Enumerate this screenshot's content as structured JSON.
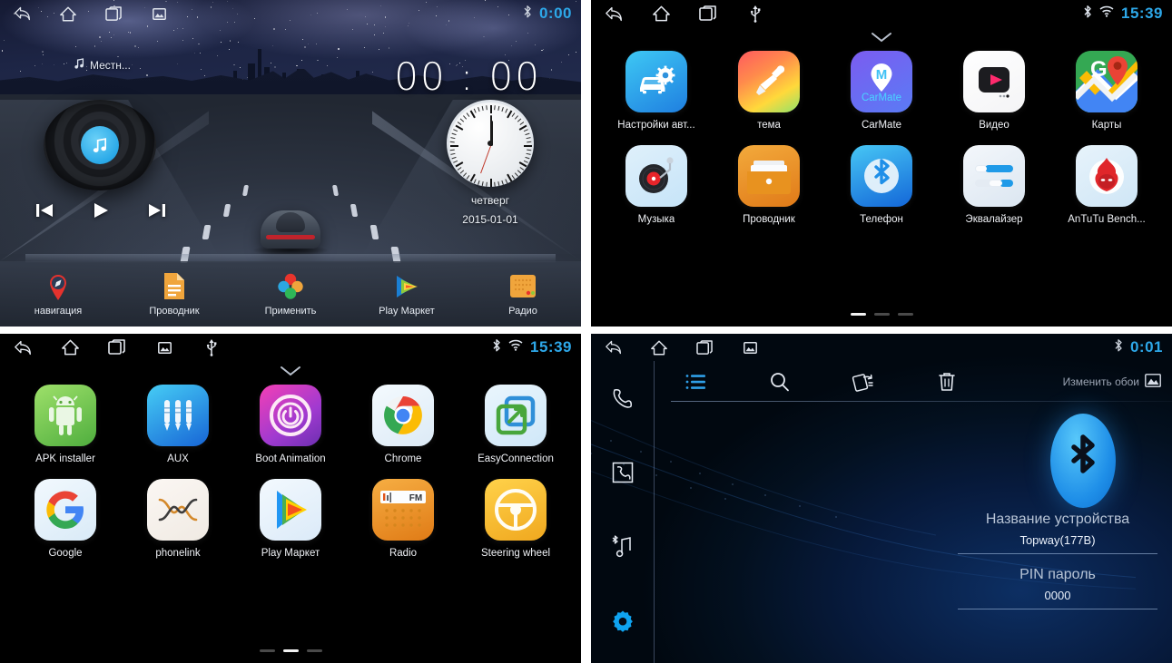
{
  "panels": {
    "home": {
      "statusbar": {
        "nav": [
          "back-icon",
          "home-icon",
          "recents-icon",
          "screenshot-icon"
        ],
        "bluetooth_icon": "bluetooth-icon",
        "time": "0:00"
      },
      "music_widget": {
        "source_label": "Местн...",
        "note_icon": "music-note-icon",
        "prev_label": "prev-track",
        "play_label": "play",
        "next_label": "next-track"
      },
      "clock_widget": {
        "digital_time": "00 : 00",
        "day_name": "четверг",
        "date": "2015-01-01",
        "hour_deg": 0,
        "minute_deg": 0,
        "second_deg": 200
      },
      "dock": [
        {
          "label": "навигация",
          "icon": "navigation-pin-icon"
        },
        {
          "label": "Проводник",
          "icon": "file-manager-icon"
        },
        {
          "label": "Применить",
          "icon": "apply-petals-icon"
        },
        {
          "label": "Play Маркет",
          "icon": "play-store-icon"
        },
        {
          "label": "Радио",
          "icon": "radio-icon"
        }
      ]
    },
    "drawer_page1": {
      "statusbar": {
        "nav": [
          "back-icon",
          "home-icon",
          "recents-icon",
          "usb-icon"
        ],
        "bluetooth_icon": "bluetooth-icon",
        "wifi_icon": "wifi-icon",
        "time": "15:39"
      },
      "caret": "chevron-down-icon",
      "apps": [
        {
          "label": "Настройки авт...",
          "icon": "car-settings-icon"
        },
        {
          "label": "тема",
          "icon": "theme-brush-icon"
        },
        {
          "label": "CarMate",
          "icon": "carmate-icon"
        },
        {
          "label": "Видео",
          "icon": "video-icon"
        },
        {
          "label": "Карты",
          "icon": "google-maps-icon"
        },
        {
          "label": "Музыка",
          "icon": "music-turntable-icon"
        },
        {
          "label": "Проводник",
          "icon": "file-folder-icon"
        },
        {
          "label": "Телефон",
          "icon": "bluetooth-phone-icon"
        },
        {
          "label": "Эквалайзер",
          "icon": "equalizer-icon"
        },
        {
          "label": "AnTuTu Bench...",
          "icon": "antutu-icon"
        }
      ],
      "pages": 3,
      "active_page": 1
    },
    "drawer_page2": {
      "statusbar": {
        "nav": [
          "back-icon",
          "home-icon",
          "recents-icon",
          "screenshot-icon",
          "usb-icon"
        ],
        "bluetooth_icon": "bluetooth-icon",
        "wifi_icon": "wifi-icon",
        "time": "15:39"
      },
      "caret": "chevron-down-icon",
      "apps": [
        {
          "label": "APK installer",
          "icon": "android-robot-icon"
        },
        {
          "label": "AUX",
          "icon": "aux-jack-icon"
        },
        {
          "label": "Boot Animation",
          "icon": "power-ring-icon"
        },
        {
          "label": "Chrome",
          "icon": "chrome-icon"
        },
        {
          "label": "EasyConnection",
          "icon": "easyconnection-icon"
        },
        {
          "label": "Google",
          "icon": "google-g-icon"
        },
        {
          "label": "phonelink",
          "icon": "phonelink-icon"
        },
        {
          "label": "Play Маркет",
          "icon": "play-store-icon"
        },
        {
          "label": "Radio",
          "icon": "fm-radio-icon"
        },
        {
          "label": "Steering wheel",
          "icon": "steering-wheel-icon"
        }
      ],
      "pages": 3,
      "active_page": 2
    },
    "bluetooth": {
      "statusbar": {
        "nav": [
          "back-icon",
          "home-icon",
          "recents-icon",
          "screenshot-icon"
        ],
        "bluetooth_icon": "bluetooth-icon",
        "time": "0:01"
      },
      "sidebar": [
        {
          "name": "dialpad-phone-icon",
          "active": false
        },
        {
          "name": "call-log-icon",
          "active": false
        },
        {
          "name": "bluetooth-music-icon",
          "active": false
        },
        {
          "name": "settings-gear-icon",
          "active": true
        }
      ],
      "toolbar": [
        {
          "name": "list-icon",
          "active": true
        },
        {
          "name": "search-icon",
          "active": false
        },
        {
          "name": "sync-contacts-icon",
          "active": false
        },
        {
          "name": "trash-icon",
          "active": false
        }
      ],
      "wallpaper_button": {
        "label": "Изменить обои",
        "icon": "image-icon"
      },
      "logo_icon": "bluetooth-logo-icon",
      "fields": [
        {
          "label": "Название устройства",
          "value": "Topway(177B)"
        },
        {
          "label": "PIN пароль",
          "value": "0000"
        }
      ]
    }
  },
  "colors": {
    "accent_time": "#2da7e8",
    "accent_blue": "#1f8fe8",
    "drawer_bg": "#000000"
  }
}
